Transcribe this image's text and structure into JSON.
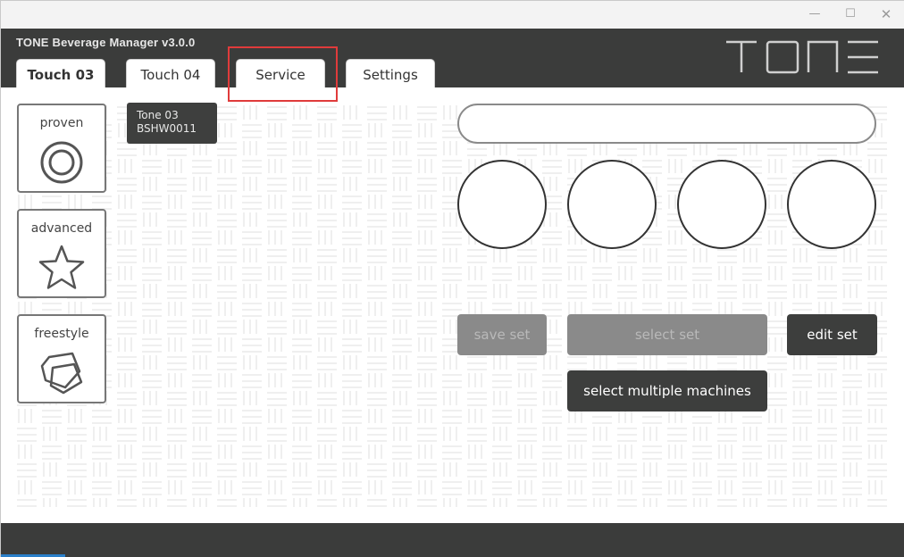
{
  "window": {
    "minimize_glyph": "—",
    "maximize_glyph": "☐",
    "close_glyph": "✕"
  },
  "header": {
    "app_title": "TONE Beverage Manager v3.0.0",
    "logo_text": "TONE"
  },
  "tabs": [
    {
      "label": "Touch 03",
      "active": true
    },
    {
      "label": "Touch 04",
      "active": false
    },
    {
      "label": "Service",
      "active": false
    },
    {
      "label": "Settings",
      "active": false
    }
  ],
  "modes": [
    {
      "label": "proven",
      "icon": "target-circle-icon"
    },
    {
      "label": "advanced",
      "icon": "star-icon"
    },
    {
      "label": "freestyle",
      "icon": "cube-icon"
    }
  ],
  "machine": {
    "name": "Tone 03",
    "serial": "BSHW0011"
  },
  "set_name": {
    "value": "",
    "placeholder": ""
  },
  "buttons": {
    "save_set": "save set",
    "select_set": "select set",
    "edit_set": "edit set",
    "select_multiple": "select multiple machines"
  },
  "colors": {
    "header_bg": "#3b3c3b",
    "highlight": "#e03b3b",
    "disabled_btn": "#8a8a8a",
    "dark_btn": "#3d3e3d"
  }
}
